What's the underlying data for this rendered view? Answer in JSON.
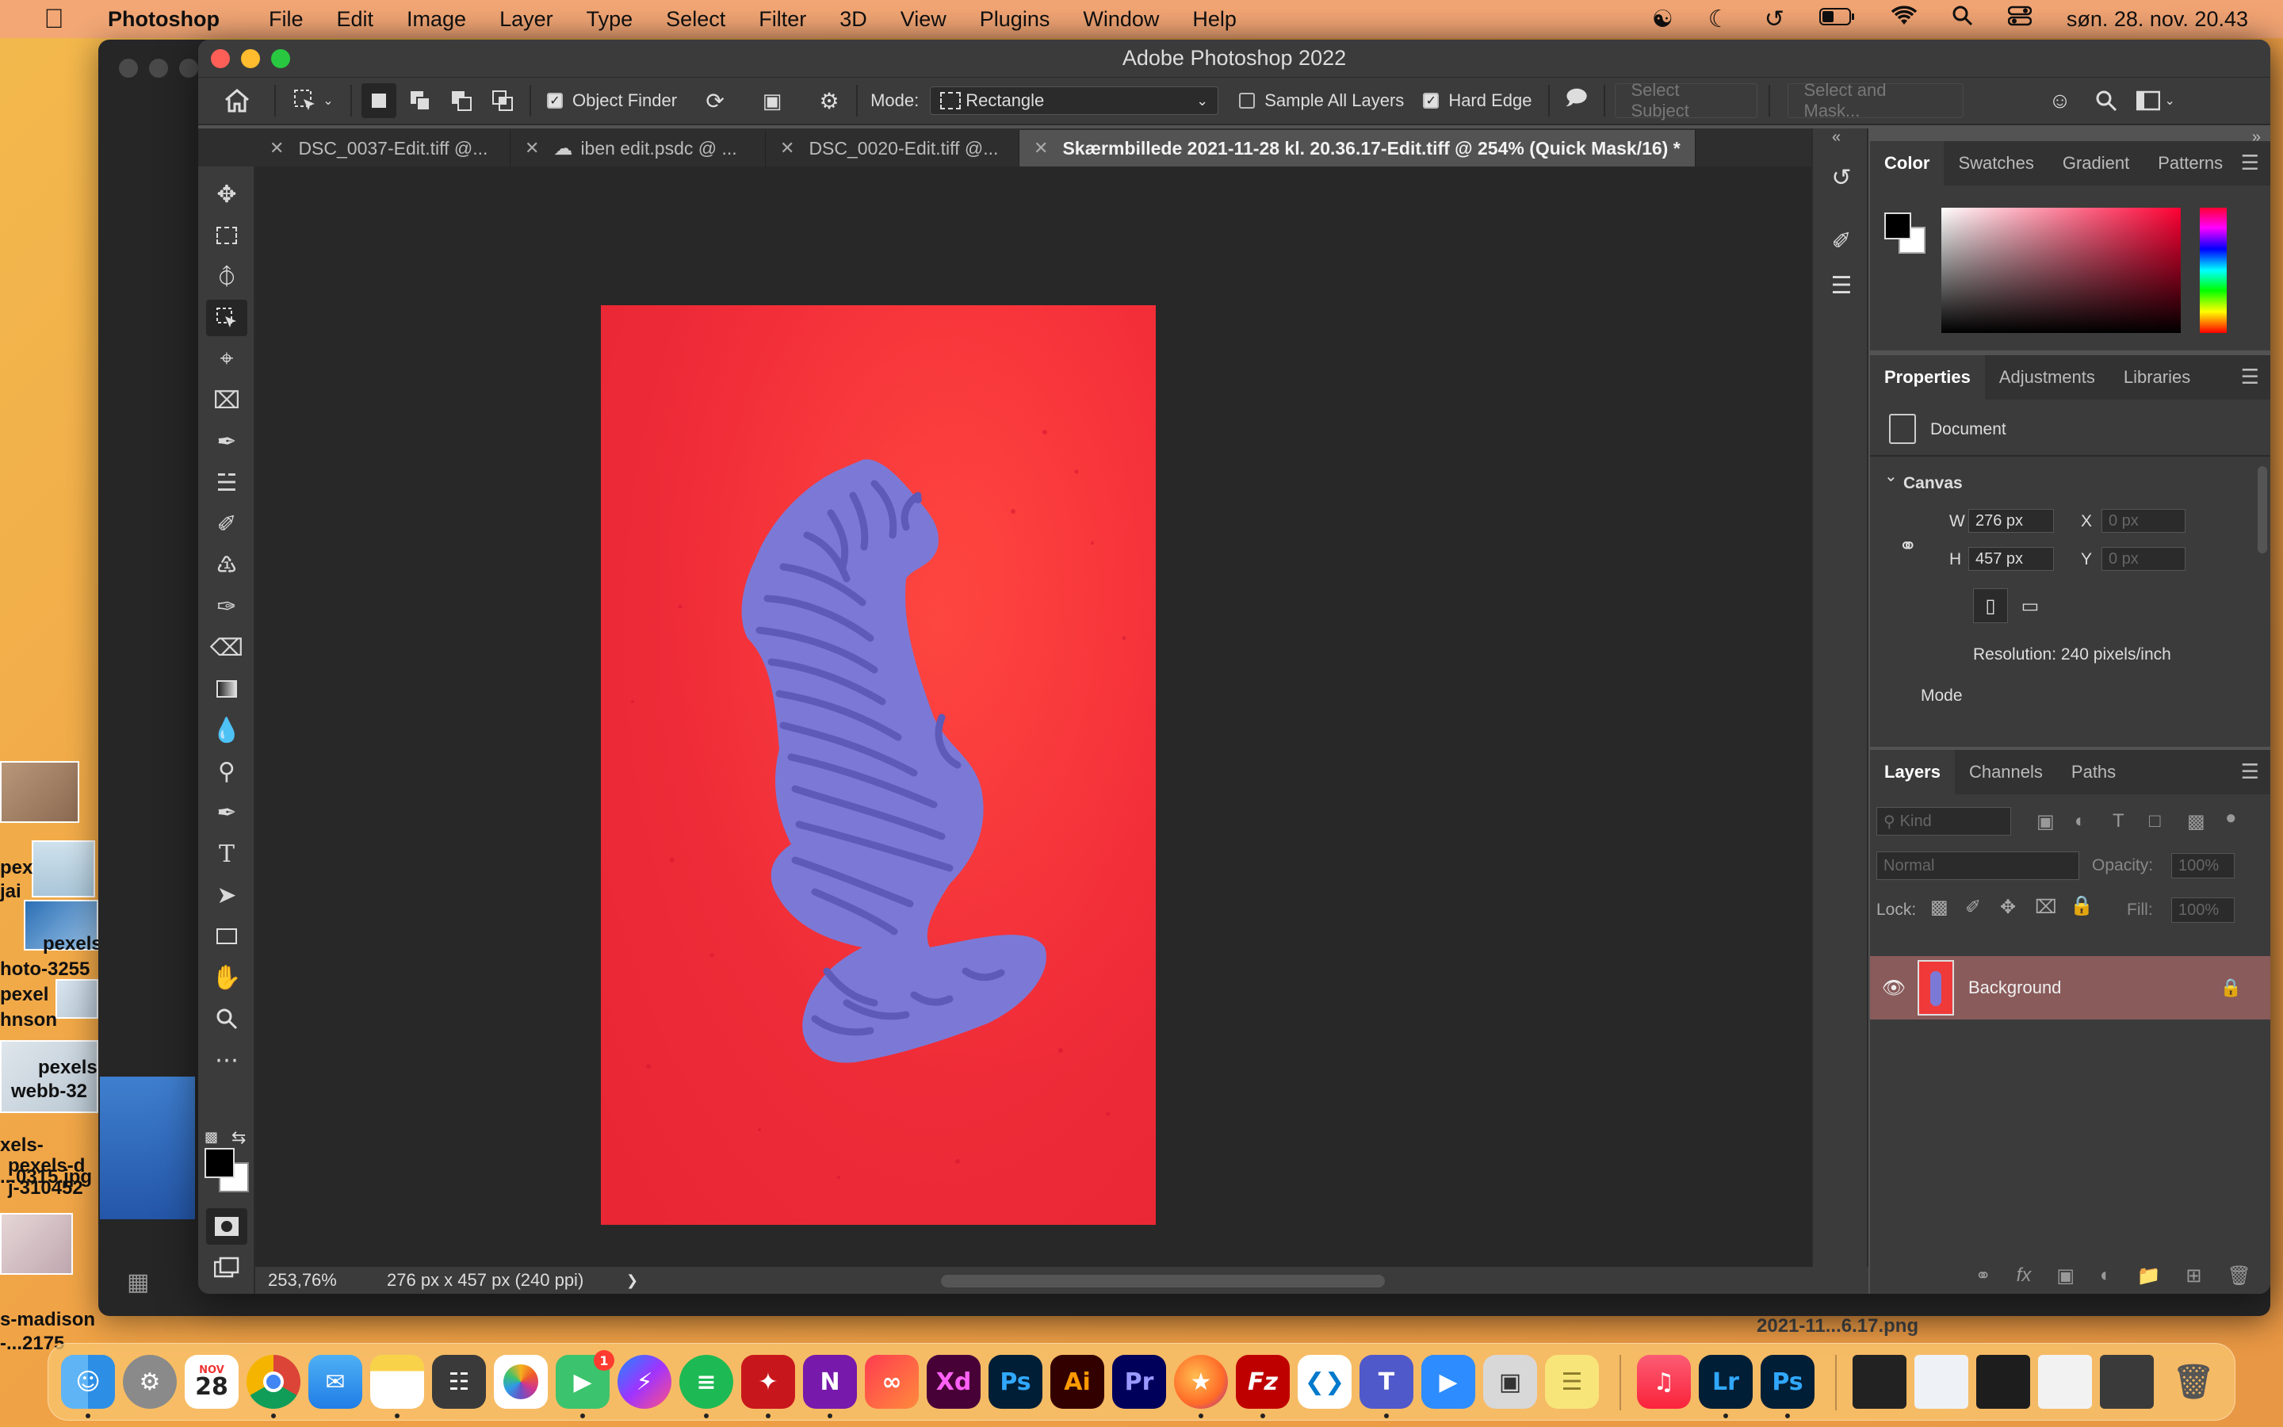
{
  "menubar": {
    "app": "Photoshop",
    "items": [
      "File",
      "Edit",
      "Image",
      "Layer",
      "Type",
      "Select",
      "Filter",
      "3D",
      "View",
      "Plugins",
      "Window",
      "Help"
    ],
    "clock": "søn. 28. nov.  20.43"
  },
  "window": {
    "title": "Adobe Photoshop 2022"
  },
  "options": {
    "object_finder": "Object Finder",
    "mode_label": "Mode:",
    "mode_value": "Rectangle",
    "sample_all_layers": "Sample All Layers",
    "hard_edge": "Hard Edge",
    "select_subject": "Select Subject",
    "select_and_mask": "Select and Mask..."
  },
  "tabs": [
    {
      "label": "DSC_0037-Edit.tiff @..."
    },
    {
      "label": "iben edit.psdc @ ..."
    },
    {
      "label": "DSC_0020-Edit.tiff @..."
    },
    {
      "label": "Skærmbillede 2021-11-28 kl. 20.36.17-Edit.tiff @ 254% (Quick Mask/16) *"
    }
  ],
  "status": {
    "zoom": "253,76%",
    "doc_info": "276 px x 457 px (240 ppi)",
    "arrow": "❯"
  },
  "color_panel": {
    "tabs": [
      "Color",
      "Swatches",
      "Gradient",
      "Patterns"
    ],
    "foreground": "#000000",
    "background": "#ffffff"
  },
  "properties_panel": {
    "tabs": [
      "Properties",
      "Adjustments",
      "Libraries"
    ],
    "doc_label": "Document",
    "canvas_section": "Canvas",
    "w_label": "W",
    "w_value": "276 px",
    "h_label": "H",
    "h_value": "457 px",
    "x_label": "X",
    "x_placeholder": "0 px",
    "y_label": "Y",
    "y_placeholder": "0 px",
    "resolution": "Resolution: 240 pixels/inch",
    "mode": "Mode"
  },
  "layers_panel": {
    "tabs": [
      "Layers",
      "Channels",
      "Paths"
    ],
    "kind_placeholder": "Kind",
    "blend_mode": "Normal",
    "opacity_label": "Opacity:",
    "opacity_value": "100%",
    "lock_label": "Lock:",
    "fill_label": "Fill:",
    "fill_value": "100%",
    "layers": [
      {
        "name": "Background",
        "visible": true,
        "locked": true
      }
    ]
  },
  "desktop": {
    "labels": [
      "pex",
      "jai",
      "pexels",
      "hoto-3255",
      "pexel",
      "hnson",
      "pexels",
      "webb-32",
      "xels-",
      "pexels-d",
      "...0315.jpg",
      "j-310452",
      "s-madison",
      "-...2175",
      "2021-11...6.17.png"
    ]
  },
  "dock": {
    "calendar_month": "NOV",
    "calendar_day": "28",
    "facetime_badge": "1",
    "apps": [
      "Finder",
      "System Preferences",
      "Calendar",
      "Chrome",
      "Mail",
      "Notes",
      "Calculator",
      "Photos",
      "FaceTime",
      "Messenger",
      "Spotify",
      "Acrobat",
      "OneNote",
      "Creative Cloud",
      "Adobe XD",
      "Photoshop",
      "Illustrator",
      "Premiere Pro",
      "Firefox",
      "FileZilla",
      "VS Code",
      "Teams",
      "Zoom",
      "Preview",
      "Stickies",
      "Music",
      "Lightroom",
      "Photoshop"
    ],
    "labels": {
      "xd": "Xd",
      "ps": "Ps",
      "ai": "Ai",
      "pr": "Pr",
      "lr": "Lr",
      "fz": "Fz"
    }
  },
  "colors": {
    "accent_red": "#f8323a",
    "mask_purple": "#7d7ad6",
    "layer_selected": "#8a5b5b"
  }
}
